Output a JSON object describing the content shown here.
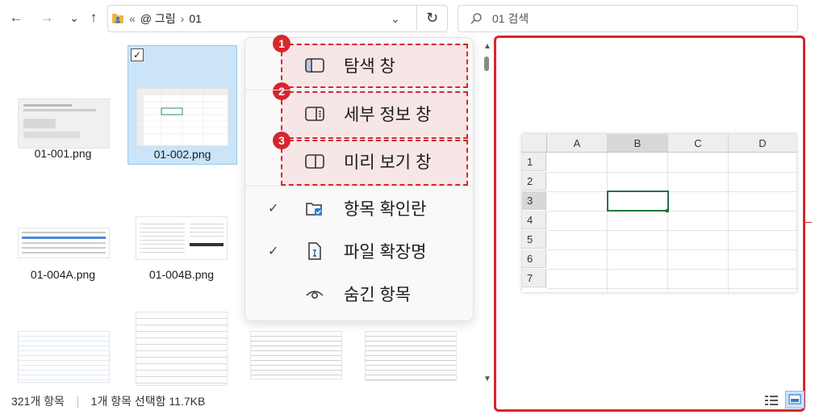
{
  "nav": {
    "back_icon": "←",
    "forward_icon": "→",
    "recent_icon": "⌄",
    "up_icon": "↑",
    "refresh_icon": "↻",
    "dropdown_icon": "⌄"
  },
  "address": {
    "overflow": "«",
    "segments": [
      "@ 그림",
      "01"
    ],
    "separator": "›"
  },
  "search": {
    "placeholder": "01 검색"
  },
  "files": [
    {
      "name": "01-001.png",
      "selected": false
    },
    {
      "name": "01-002.png",
      "selected": true
    },
    {
      "name": "01-004A.png",
      "selected": false
    },
    {
      "name": "01-004B.png",
      "selected": false
    }
  ],
  "check_mark": "✓",
  "menu": {
    "items": [
      {
        "label": "탐색 창",
        "icon": "navigation-pane-icon",
        "badge": "1",
        "highlighted": true
      },
      {
        "label": "세부 정보 창",
        "icon": "details-pane-icon",
        "badge": "2",
        "highlighted": true
      },
      {
        "label": "미리 보기 창",
        "icon": "preview-pane-icon",
        "badge": "3",
        "highlighted": true
      },
      {
        "label": "항목 확인란",
        "icon": "item-checkbox-icon",
        "checked": true
      },
      {
        "label": "파일 확장명",
        "icon": "file-extension-icon",
        "checked": true
      },
      {
        "label": "숨긴 항목",
        "icon": "hidden-items-icon",
        "checked": false
      }
    ]
  },
  "preview": {
    "columns": [
      "A",
      "B",
      "C",
      "D"
    ],
    "rows": [
      "1",
      "2",
      "3",
      "4",
      "5",
      "6",
      "7"
    ]
  },
  "status": {
    "count": "321개 항목",
    "selection": "1개 항목 선택함 11.7KB"
  },
  "colors": {
    "highlight": "#d7262e",
    "selection": "#cce4f7"
  }
}
